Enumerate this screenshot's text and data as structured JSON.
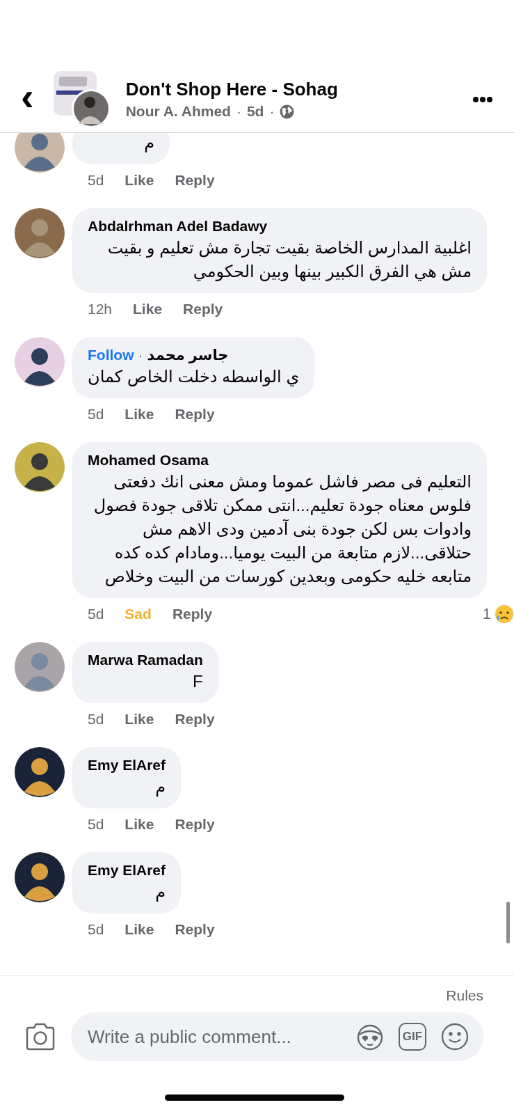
{
  "header": {
    "back": "‹",
    "title": "Don't Shop Here - Sohag",
    "author": "Nour A. Ahmed",
    "time": "5d",
    "separator": "·"
  },
  "comments": [
    {
      "text": "م",
      "time": "5d",
      "reaction": {
        "label": "Like",
        "kind": "none"
      },
      "reply": "Reply"
    },
    {
      "name": "Abdalrhman Adel Badawy",
      "text": "اغلبية المدارس الخاصة بقيت تجارة مش تعليم و بقيت مش هي الفرق الكبير بينها وبين الحكومي",
      "time": "12h",
      "reaction": {
        "label": "Like",
        "kind": "none"
      },
      "reply": "Reply"
    },
    {
      "name": "جاسر محمد",
      "follow": "Follow",
      "text": "ي الواسطه دخلت الخاص كمان",
      "time": "5d",
      "reaction": {
        "label": "Like",
        "kind": "none"
      },
      "reply": "Reply"
    },
    {
      "name": "Mohamed Osama",
      "text": "التعليم فى مصر فاشل عموما ومش معنى انك دفعتى فلوس معناه جودة تعليم...انتى ممكن تلاقى جودة فصول وادوات بس لكن جودة بنى آدمين ودى الاهم مش حتلاقى...لازم متابعة من البيت يوميا...ومادام كده كده متابعه خليه حكومى وبعدين كورسات من البيت وخلاص",
      "time": "5d",
      "reaction": {
        "label": "Sad",
        "kind": "sad"
      },
      "reply": "Reply",
      "count": {
        "value": "1",
        "kind": "sad"
      }
    },
    {
      "name": "Marwa Ramadan",
      "text": "F",
      "time": "5d",
      "reaction": {
        "label": "Like",
        "kind": "none"
      },
      "reply": "Reply"
    },
    {
      "name": "Emy ElAref",
      "text": "م",
      "time": "5d",
      "reaction": {
        "label": "Like",
        "kind": "none"
      },
      "reply": "Reply"
    },
    {
      "name": "Emy ElAref",
      "text": "م",
      "time": "5d",
      "reaction": {
        "label": "Like",
        "kind": "none"
      },
      "reply": "Reply"
    }
  ],
  "composer": {
    "rules": "Rules",
    "placeholder": "Write a public comment...",
    "gif": "GIF"
  }
}
